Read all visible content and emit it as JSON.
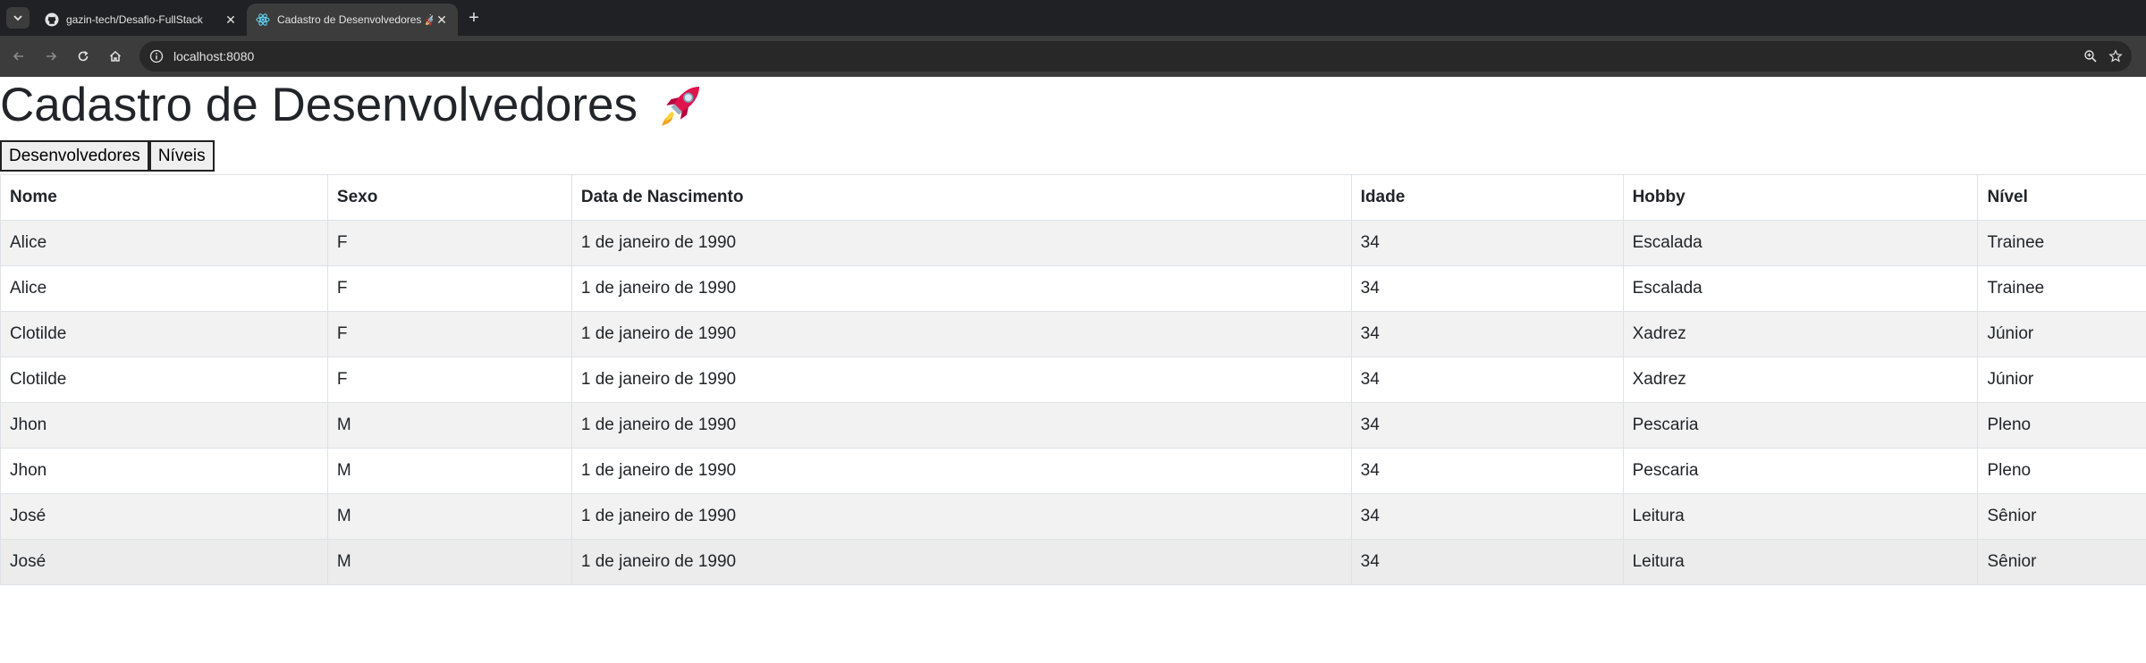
{
  "browser": {
    "tabs": [
      {
        "title": "gazin-tech/Desafio-FullStack",
        "favicon": "github-icon",
        "active": false
      },
      {
        "title": "Cadastro de Desenvolvedores 🚀",
        "favicon": "react-icon",
        "active": true
      }
    ],
    "address_bar": {
      "url": "localhost:8080"
    },
    "colors": {
      "tabstrip": "#202124",
      "toolbar": "#3c3c3c",
      "omnibox": "#282828"
    }
  },
  "page": {
    "title": "Cadastro de Desenvolvedores",
    "title_icon": "rocket-icon",
    "nav_buttons": [
      "Desenvolvedores",
      "Níveis"
    ],
    "table": {
      "headers": [
        "Nome",
        "Sexo",
        "Data de Nascimento",
        "Idade",
        "Hobby",
        "Nível"
      ],
      "rows": [
        [
          "Alice",
          "F",
          "1 de janeiro de 1990",
          "34",
          "Escalada",
          "Trainee"
        ],
        [
          "Alice",
          "F",
          "1 de janeiro de 1990",
          "34",
          "Escalada",
          "Trainee"
        ],
        [
          "Clotilde",
          "F",
          "1 de janeiro de 1990",
          "34",
          "Xadrez",
          "Júnior"
        ],
        [
          "Clotilde",
          "F",
          "1 de janeiro de 1990",
          "34",
          "Xadrez",
          "Júnior"
        ],
        [
          "Jhon",
          "M",
          "1 de janeiro de 1990",
          "34",
          "Pescaria",
          "Pleno"
        ],
        [
          "Jhon",
          "M",
          "1 de janeiro de 1990",
          "34",
          "Pescaria",
          "Pleno"
        ],
        [
          "José",
          "M",
          "1 de janeiro de 1990",
          "34",
          "Leitura",
          "Sênior"
        ],
        [
          "José",
          "M",
          "1 de janeiro de 1990",
          "34",
          "Leitura",
          "Sênior"
        ]
      ]
    }
  }
}
